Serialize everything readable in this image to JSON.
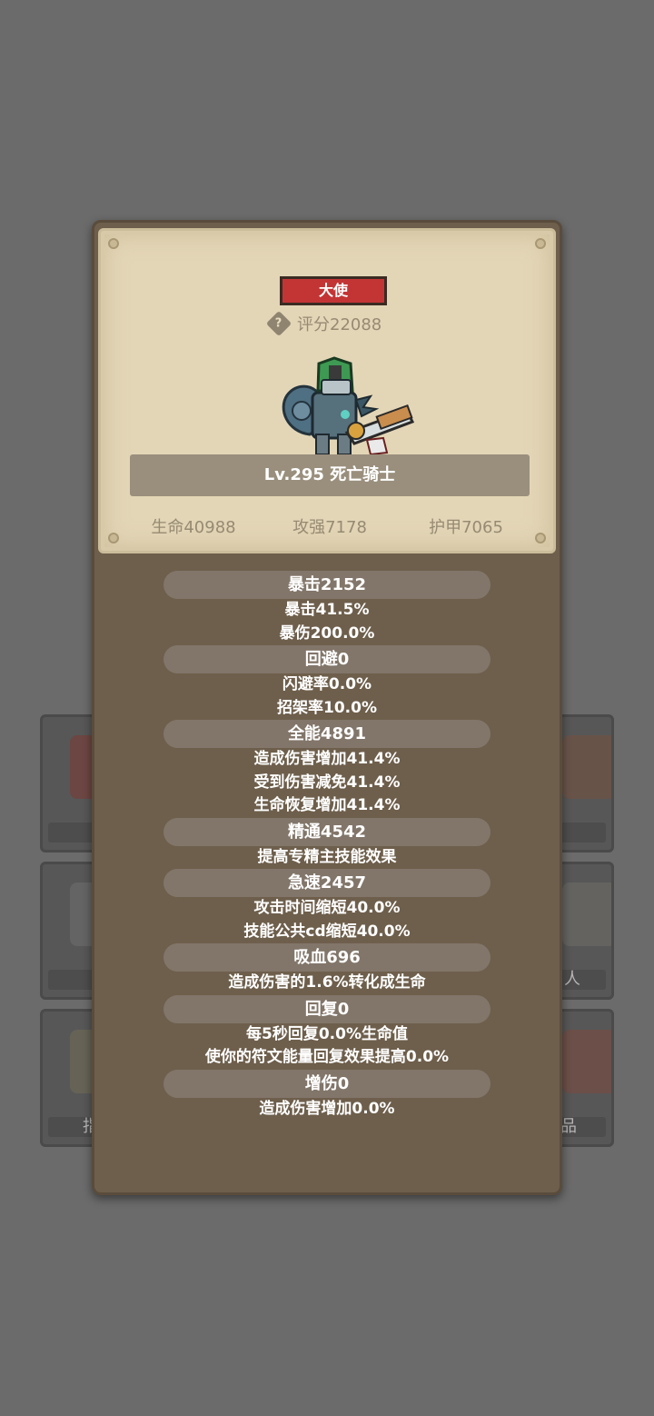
{
  "rank_badge": "大使",
  "score": "评分22088",
  "hero": {
    "name": "Lv.295 死亡骑士"
  },
  "base_stats": {
    "hp": "生命40988",
    "attack": "攻强7178",
    "armor": "护甲7065"
  },
  "attributes": [
    {
      "title": "暴击2152",
      "lines": [
        "暴击41.5%",
        "暴伤200.0%"
      ]
    },
    {
      "title": "回避0",
      "lines": [
        "闪避率0.0%",
        "招架率10.0%"
      ]
    },
    {
      "title": "全能4891",
      "lines": [
        "造成伤害增加41.4%",
        "受到伤害减免41.4%",
        "生命恢复增加41.4%"
      ]
    },
    {
      "title": "精通4542",
      "lines": [
        "提高专精主技能效果"
      ]
    },
    {
      "title": "急速2457",
      "lines": [
        "攻击时间缩短40.0%",
        "技能公共cd缩短40.0%"
      ]
    },
    {
      "title": "吸血696",
      "lines": [
        "造成伤害的1.6%转化成生命"
      ]
    },
    {
      "title": "回复0",
      "lines": [
        "每5秒回复0.0%生命值",
        "使你的符文能量回复效果提高0.0%"
      ]
    },
    {
      "title": "增伤0",
      "lines": [
        "造成伤害增加0.0%"
      ]
    }
  ],
  "background_cards": {
    "right_middle_label": "人",
    "left_bottom_label": "指",
    "right_bottom_label": "品"
  },
  "colors": {
    "badge_red": "#c33535",
    "panel_brown": "#6e5f4c",
    "parchment": "#e3d6b7"
  },
  "icons": {
    "help": "question-diamond-icon"
  }
}
